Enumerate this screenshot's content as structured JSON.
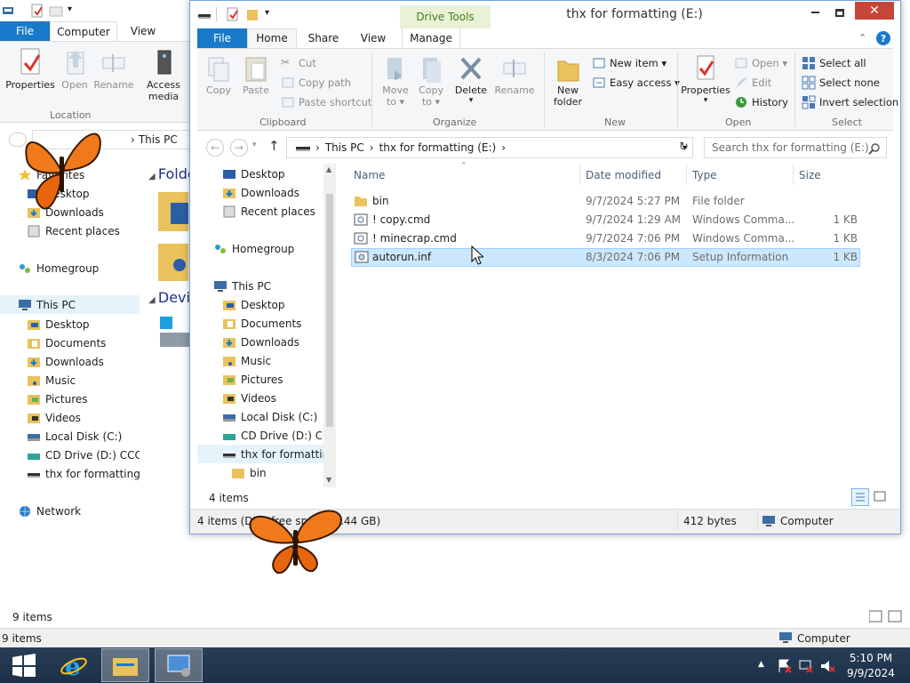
{
  "back_window": {
    "tabs": {
      "file": "File",
      "computer": "Computer",
      "view": "View"
    },
    "ribbon": {
      "properties": "Properties",
      "open": "Open",
      "rename": "Rename",
      "access_media": "Access media ▾",
      "access_line1": "Access",
      "access_line2": "media",
      "group_location": "Location"
    },
    "address": {
      "crumb": "This PC"
    },
    "nav": {
      "favorites": "Favorites",
      "desktop": "Desktop",
      "downloads": "Downloads",
      "recent": "Recent places",
      "homegroup": "Homegroup",
      "this_pc": "This PC",
      "pc_desktop": "Desktop",
      "documents": "Documents",
      "pc_downloads": "Downloads",
      "music": "Music",
      "pictures": "Pictures",
      "videos": "Videos",
      "local_disk": "Local Disk (C:)",
      "cd_drive": "CD Drive (D:) CCCOMA",
      "usb": "thx for formatting (E:)",
      "network": "Network"
    },
    "content": {
      "folders_heading": "Folders",
      "devices_heading": "Devices"
    },
    "status_items": "9 items",
    "status_bar": "9 items",
    "status_computer": "Computer"
  },
  "front_window": {
    "title": "thx for formatting (E:)",
    "drive_tools": "Drive Tools",
    "tabs": {
      "file": "File",
      "home": "Home",
      "share": "Share",
      "view": "View",
      "manage": "Manage"
    },
    "ribbon": {
      "copy": "Copy",
      "paste": "Paste",
      "cut": "Cut",
      "copy_path": "Copy path",
      "paste_shortcut": "Paste shortcut",
      "group_clipboard": "Clipboard",
      "move_to_1": "Move",
      "move_to_2": "to ▾",
      "copy_to_1": "Copy",
      "copy_to_2": "to ▾",
      "delete": "Delete",
      "delete_arrow": "▾",
      "rename": "Rename",
      "group_organize": "Organize",
      "new_folder_1": "New",
      "new_folder_2": "folder",
      "new_item": "New item ▾",
      "easy_access": "Easy access ▾",
      "group_new": "New",
      "properties": "Properties",
      "properties_arrow": "▾",
      "open": "Open ▾",
      "edit": "Edit",
      "history": "History",
      "group_open": "Open",
      "select_all": "Select all",
      "select_none": "Select none",
      "invert_selection": "Invert selection",
      "group_select": "Select"
    },
    "address": {
      "crumb1": "This PC",
      "crumb2": "thx for formatting (E:)",
      "sep": "›"
    },
    "search_placeholder": "Search thx for formatting (E:)",
    "nav": {
      "desktop": "Desktop",
      "downloads": "Downloads",
      "recent": "Recent places",
      "homegroup": "Homegroup",
      "this_pc": "This PC",
      "pc_desktop": "Desktop",
      "documents": "Documents",
      "pc_downloads": "Downloads",
      "music": "Music",
      "pictures": "Pictures",
      "videos": "Videos",
      "local_disk": "Local Disk (C:)",
      "cd_drive": "CD Drive (D:) CCCOMA",
      "usb": "thx for formatting (E:)",
      "bin": "bin"
    },
    "columns": {
      "name": "Name",
      "date": "Date modified",
      "type": "Type",
      "size": "Size"
    },
    "files": [
      {
        "name": "bin",
        "date": "9/7/2024 5:27 PM",
        "type": "File folder",
        "size": ""
      },
      {
        "name": "! copy.cmd",
        "date": "9/7/2024 1:29 AM",
        "type": "Windows Comma...",
        "size": "1 KB"
      },
      {
        "name": "! minecrap.cmd",
        "date": "9/7/2024 7:06 PM",
        "type": "Windows Comma...",
        "size": "1 KB"
      },
      {
        "name": "autorun.inf",
        "date": "8/3/2024 7:06 PM",
        "type": "Setup Information",
        "size": "1 KB"
      }
    ],
    "items_count": "4 items",
    "status": {
      "left": "4 items (Disk free space: 9.44 GB)",
      "size": "412 bytes",
      "computer": "Computer"
    }
  },
  "taskbar": {
    "time": "5:10 PM",
    "date": "9/9/2024"
  },
  "colors": {
    "accent": "#1979ca",
    "selection": "#cce8ff",
    "taskbar": "#1d3048"
  }
}
